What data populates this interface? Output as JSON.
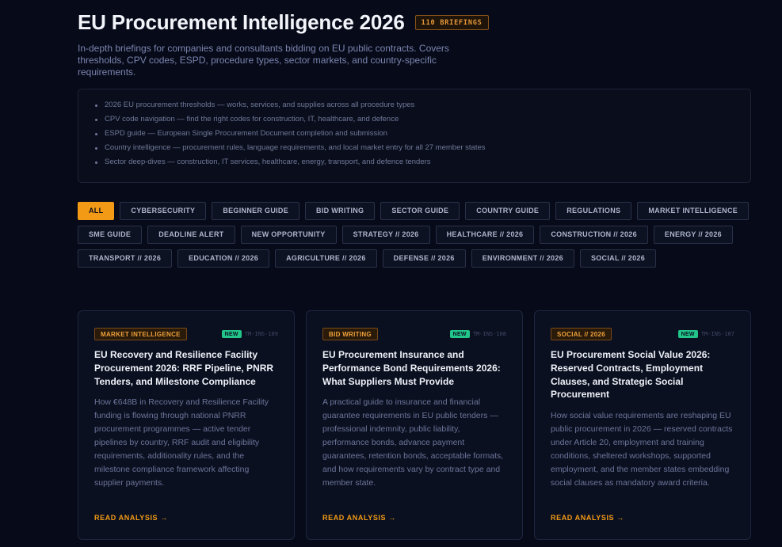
{
  "header": {
    "title": "EU Procurement Intelligence 2026",
    "badge": "110 BRIEFINGS",
    "subtitle": "In-depth briefings for companies and consultants bidding on EU public contracts. Covers thresholds, CPV codes, ESPD, procedure types, sector markets, and country-specific requirements."
  },
  "highlights": [
    "2026 EU procurement thresholds — works, services, and supplies across all procedure types",
    "CPV code navigation — find the right codes for construction, IT, healthcare, and defence",
    "ESPD guide — European Single Procurement Document completion and submission",
    "Country intelligence — procurement rules, language requirements, and local market entry for all 27 member states",
    "Sector deep-dives — construction, IT services, healthcare, energy, transport, and defence tenders"
  ],
  "filters": [
    "ALL",
    "CYBERSECURITY",
    "BEGINNER GUIDE",
    "BID WRITING",
    "SECTOR GUIDE",
    "COUNTRY GUIDE",
    "REGULATIONS",
    "MARKET INTELLIGENCE",
    "SME GUIDE",
    "DEADLINE ALERT",
    "NEW OPPORTUNITY",
    "STRATEGY // 2026",
    "HEALTHCARE // 2026",
    "CONSTRUCTION // 2026",
    "ENERGY // 2026",
    "TRANSPORT // 2026",
    "EDUCATION // 2026",
    "AGRICULTURE // 2026",
    "DEFENSE // 2026",
    "ENVIRONMENT // 2026",
    "SOCIAL // 2026"
  ],
  "active_filter": "ALL",
  "cards": [
    {
      "category": "MARKET INTELLIGENCE",
      "new_label": "NEW",
      "id": "TM-INS-109",
      "title": "EU Recovery and Resilience Facility Procurement 2026: RRF Pipeline, PNRR Tenders, and Milestone Compliance",
      "description": "How €648B in Recovery and Resilience Facility funding is flowing through national PNRR procurement programmes — active tender pipelines by country, RRF audit and eligibility requirements, additionality rules, and the milestone compliance framework affecting supplier payments.",
      "link": "READ ANALYSIS →"
    },
    {
      "category": "BID WRITING",
      "new_label": "NEW",
      "id": "TM-INS-108",
      "title": "EU Procurement Insurance and Performance Bond Requirements 2026: What Suppliers Must Provide",
      "description": "A practical guide to insurance and financial guarantee requirements in EU public tenders — professional indemnity, public liability, performance bonds, advance payment guarantees, retention bonds, acceptable formats, and how requirements vary by contract type and member state.",
      "link": "READ ANALYSIS →"
    },
    {
      "category": "SOCIAL // 2026",
      "new_label": "NEW",
      "id": "TM-INS-107",
      "title": "EU Procurement Social Value 2026: Reserved Contracts, Employment Clauses, and Strategic Social Procurement",
      "description": "How social value requirements are reshaping EU public procurement in 2026 — reserved contracts under Article 20, employment and training conditions, sheltered workshops, supported employment, and the member states embedding social clauses as mandatory award criteria.",
      "link": "READ ANALYSIS →"
    }
  ],
  "colors": {
    "background": "#070a18",
    "accent": "#f29a16",
    "new_badge": "#22c48a"
  }
}
